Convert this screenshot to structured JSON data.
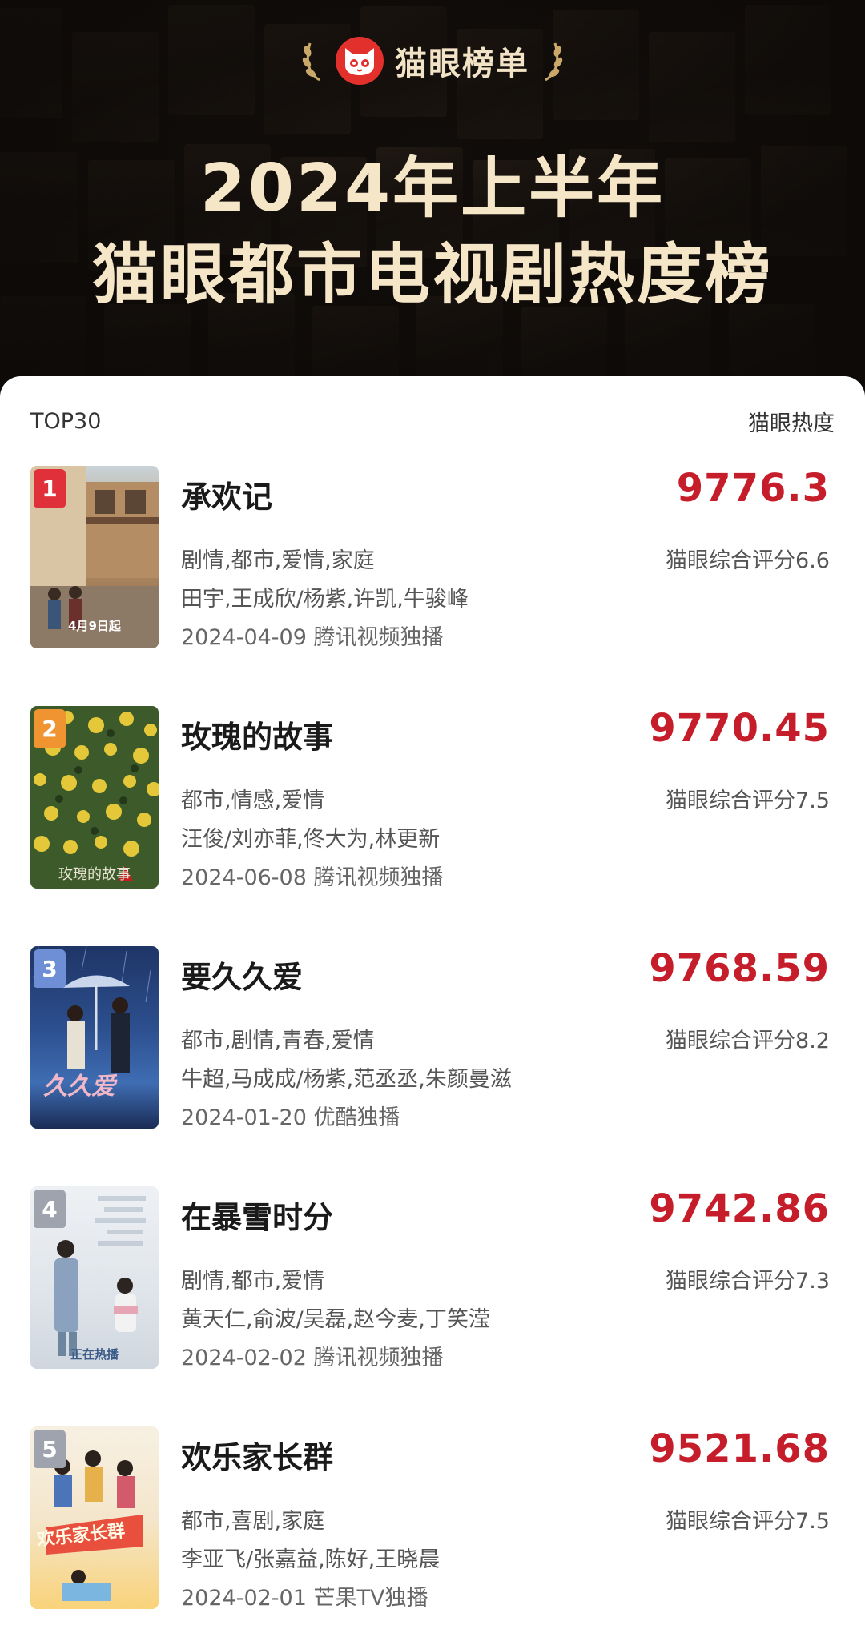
{
  "brand": {
    "name": "猫眼榜单"
  },
  "header": {
    "title_line1": "2024年上半年",
    "title_line2": "猫眼都市电视剧热度榜"
  },
  "list": {
    "left_label": "TOP30",
    "right_label": "猫眼热度",
    "items": [
      {
        "rank": "1",
        "title": "承欢记",
        "score": "9776.3",
        "genres": "剧情,都市,爱情,家庭",
        "rating": "猫眼综合评分6.6",
        "cast": "田宇,王成欣/杨紫,许凯,牛骏峰",
        "release": "2024-04-09 腾讯视频独播",
        "poster_text": "4月9日起"
      },
      {
        "rank": "2",
        "title": "玫瑰的故事",
        "score": "9770.45",
        "genres": "都市,情感,爱情",
        "rating": "猫眼综合评分7.5",
        "cast": "汪俊/刘亦菲,佟大为,林更新",
        "release": "2024-06-08 腾讯视频独播",
        "poster_text": "玫瑰的故事"
      },
      {
        "rank": "3",
        "title": "要久久爱",
        "score": "9768.59",
        "genres": "都市,剧情,青春,爱情",
        "rating": "猫眼综合评分8.2",
        "cast": "牛超,马成成/杨紫,范丞丞,朱颜曼滋",
        "release": "2024-01-20 优酷独播",
        "poster_text": "久久爱"
      },
      {
        "rank": "4",
        "title": "在暴雪时分",
        "score": "9742.86",
        "genres": "剧情,都市,爱情",
        "rating": "猫眼综合评分7.3",
        "cast": "黄天仁,俞波/吴磊,赵今麦,丁笑滢",
        "release": "2024-02-02 腾讯视频独播",
        "poster_text": "正在热播"
      },
      {
        "rank": "5",
        "title": "欢乐家长群",
        "score": "9521.68",
        "genres": "都市,喜剧,家庭",
        "rating": "猫眼综合评分7.5",
        "cast": "李亚飞/张嘉益,陈好,王晓晨",
        "release": "2024-02-01 芒果TV独播",
        "poster_text": "欢乐家长群"
      }
    ]
  },
  "colors": {
    "score": "#c61d2b",
    "badge_1": "#e0313b",
    "badge_2": "#f09331",
    "badge_3": "#6e8fd6",
    "badge_4": "#9ea3ad",
    "badge_5": "#9ea3ad"
  }
}
